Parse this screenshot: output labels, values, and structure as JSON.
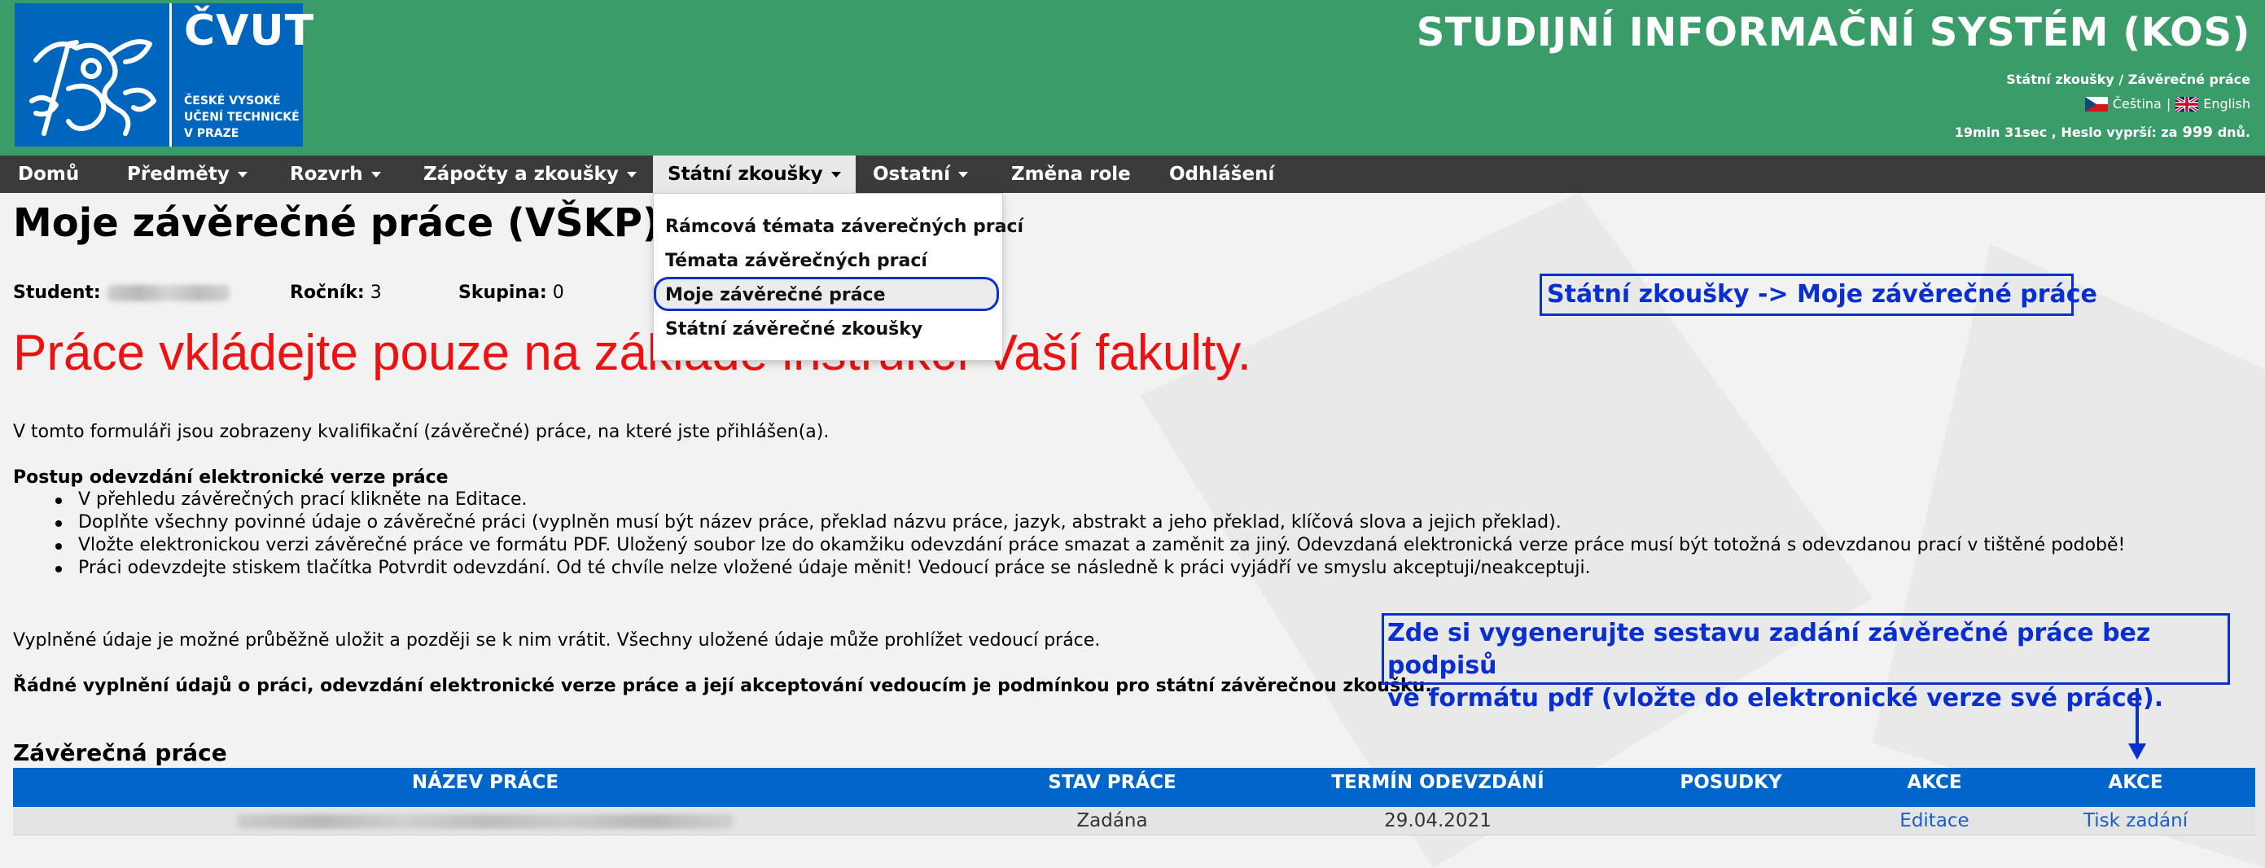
{
  "header": {
    "logo": {
      "brand": "ČVUT",
      "subtitle": "ČESKÉ VYSOKÉ\nUČENÍ TECHNICKÉ\nV PRAZE"
    },
    "system_title": "STUDIJNÍ INFORMAČNÍ SYSTÉM (KOS)",
    "breadcrumb": "Státní zkoušky / Závěrečné práce",
    "languages": {
      "czech": "Čeština",
      "separator": "|",
      "english": "English"
    },
    "session": {
      "timer": "19min 31sec ,",
      "password_label": "Heslo vyprší: za",
      "password_days": "999",
      "days_unit": "dnů."
    }
  },
  "nav": {
    "items": [
      {
        "label": "Domů",
        "dropdown": false
      },
      {
        "label": "Předměty",
        "dropdown": true
      },
      {
        "label": "Rozvrh",
        "dropdown": true
      },
      {
        "label": "Zápočty a zkoušky",
        "dropdown": true
      },
      {
        "label": "Státní zkoušky",
        "dropdown": true,
        "active": true
      },
      {
        "label": "Ostatní",
        "dropdown": true
      },
      {
        "label": "Změna role",
        "dropdown": false
      },
      {
        "label": "Odhlášení",
        "dropdown": false
      }
    ],
    "dropdown_items": [
      "Rámcová témata záverečných prací",
      "Témata závěrečných prací",
      "Moje závěrečné práce",
      "Státní závěrečné zkoušky"
    ]
  },
  "page": {
    "title": "Moje závěrečné práce (VŠKP)",
    "student_label": "Student:",
    "year_label": "Ročník:",
    "year_value": "3",
    "group_label": "Skupina:",
    "group_value": "0",
    "warning": "Práce vkládejte pouze na základě instrukcí Vaší fakulty.",
    "intro": "V tomto formuláři jsou zobrazeny kvalifikační (závěrečné) práce, na které jste přihlášen(a).",
    "procedure_title": "Postup odevzdání elektronické verze práce",
    "steps": [
      "V přehledu závěrečných prací klikněte na Editace.",
      "Doplňte všechny povinné údaje o závěrečné práci (vyplněn musí být název práce, překlad názvu práce, jazyk, abstrakt a jeho překlad, klíčová slova a jejich překlad).",
      "Vložte elektronickou verzi závěrečné práce ve formátu PDF. Uložený soubor lze do okamžiku odevzdání práce smazat a zaměnit za jiný. Odevzdaná elektronická verze práce musí být totožná s odevzdanou prací v tištěné podobě!",
      "Práci odevzdejte stiskem tlačítka Potvrdit odevzdání. Od té chvíle nelze vložené údaje měnit! Vedoucí práce se následně k práci vyjádří ve smyslu akceptuji/neakceptuji."
    ],
    "save_note": "Vyplněné údaje je možné průběžně uložit a později se k nim vrátit. Všechny uložené údaje může prohlížet vedoucí práce.",
    "condition_note": "Řádné vyplnění údajů o práci, odevzdání elektronické verze práce a její akceptování vedoucím je podmínkou pro státní závěrečnou zkoušku.",
    "section_title": "Závěrečná práce"
  },
  "table": {
    "headers": [
      "NÁZEV PRÁCE",
      "STAV PRÁCE",
      "TERMÍN ODEVZDÁNÍ",
      "POSUDKY",
      "AKCE",
      "AKCE"
    ],
    "rows": [
      {
        "status": "Zadána",
        "deadline": "29.04.2021",
        "reviews": "",
        "action_edit": "Editace",
        "action_print": "Tisk zadání"
      }
    ]
  },
  "annotations": {
    "menu_hint": "Státní zkoušky -> Moje závěrečné práce",
    "print_hint": "Zde si vygenerujte sestavu zadání závěrečné práce bez podpisů\nve formátu pdf (vložte do elektronické verze své práce)."
  },
  "colors": {
    "header_green": "#3a9c68",
    "logo_blue": "#0065bd",
    "nav_dark": "#3b3b3b",
    "table_header_blue": "#0066cc",
    "warning_red": "#ee1111",
    "annotation_blue": "#0a2fd0",
    "link_blue": "#1a5fc7"
  }
}
